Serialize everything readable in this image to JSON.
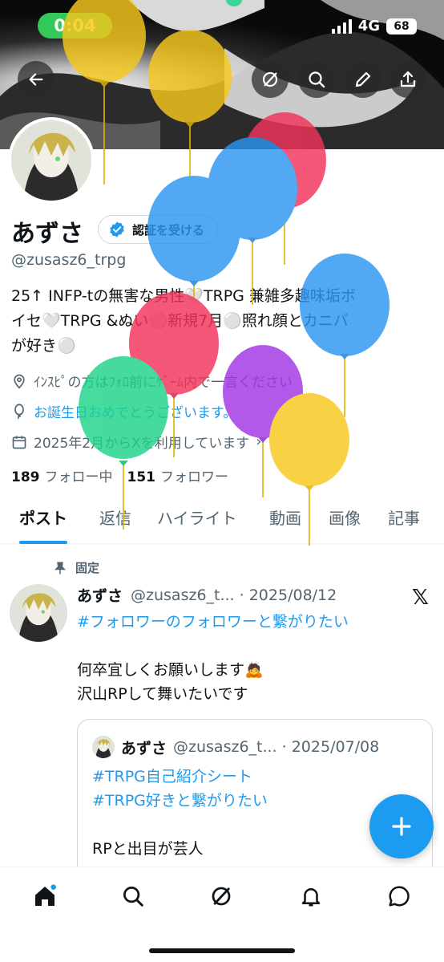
{
  "status_bar": {
    "time": "0:04",
    "network": "4G",
    "battery": "68"
  },
  "profile": {
    "name": "あずさ",
    "verify_label": "認証を受ける",
    "handle": "@zusasz6_trpg",
    "bio_lines": [
      "25↑ INFP-tの無害な男性🤍TRPG 兼雑多趣味垢ボ",
      "イセ🤍TRPG &ぬい⚪️新規7月⚪️照れ顔とカニバ",
      "が好き⚪️"
    ],
    "location": "ｲﾝｽﾋﾟの方はﾌｫﾛ前にｹﾞｰﾑ内で一言ください",
    "birthday": "お誕生日おめでとうございます。",
    "joined": "2025年2月からXを利用しています",
    "following_count": "189",
    "following_label": "フォロー中",
    "followers_count": "151",
    "followers_label": "フォロワー"
  },
  "tabs": [
    "ポスト",
    "返信",
    "ハイライト",
    "動画",
    "画像",
    "記事"
  ],
  "post": {
    "pinned_label": "固定",
    "author": "あずさ",
    "handle_date": "@zusasz6_t... · 2025/08/12",
    "hashtag": "#フォロワーのフォロワーと繋がりたい",
    "text_lines": [
      "何卒宜しくお願いします🙇",
      "沢山RPして舞いたいです"
    ],
    "quote": {
      "author": "あずさ",
      "handle_date": "@zusasz6_t... · 2025/07/08",
      "hashtag1": "#TRPG自己紹介シート",
      "hashtag2": "#TRPG好きと繋がりたい",
      "text": "RPと出目が芸人"
    }
  },
  "colors": {
    "accent": "#1d9bf0",
    "status_green": "#34c759"
  },
  "icons": {
    "header": [
      "back-arrow-icon",
      "grok-icon",
      "search-icon",
      "edit-icon",
      "share-icon"
    ],
    "nav": [
      "home-icon",
      "search-icon",
      "grok-icon",
      "bell-icon",
      "messages-icon"
    ]
  }
}
